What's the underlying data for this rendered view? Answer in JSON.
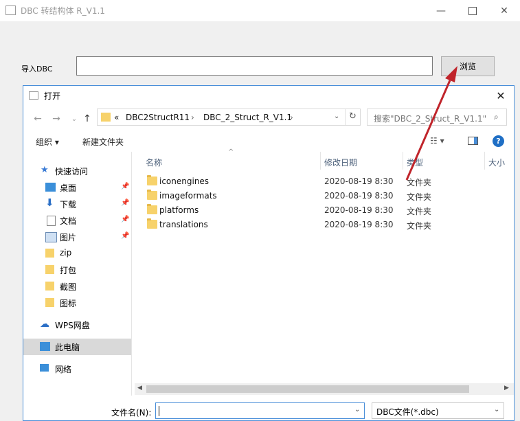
{
  "main_window": {
    "title": "DBC 转结构体 R_V1.1",
    "dbc_label": "导入DBC",
    "dbc_value": "",
    "browse_label": "浏览"
  },
  "dialog": {
    "title": "打开",
    "address": [
      "DBC2StructR11",
      "DBC_2_Struct_R_V1.1"
    ],
    "address_prefix": "«",
    "search_placeholder": "搜索\"DBC_2_Struct_R_V1.1\"",
    "toolbar": {
      "organize": "组织 ▾",
      "new_folder": "新建文件夹"
    },
    "nav": [
      {
        "label": "快速访问",
        "icon": "star-icon"
      },
      {
        "label": "桌面",
        "icon": "desktop-icon",
        "pinned": true
      },
      {
        "label": "下载",
        "icon": "download-icon",
        "pinned": true
      },
      {
        "label": "文档",
        "icon": "document-icon",
        "pinned": true
      },
      {
        "label": "图片",
        "icon": "picture-icon",
        "pinned": true
      },
      {
        "label": "zip",
        "icon": "folder-icon"
      },
      {
        "label": "打包",
        "icon": "folder-icon"
      },
      {
        "label": "截图",
        "icon": "folder-icon"
      },
      {
        "label": "图标",
        "icon": "folder-icon"
      },
      {
        "label": "WPS网盘",
        "icon": "cloud-icon"
      },
      {
        "label": "此电脑",
        "icon": "computer-icon"
      },
      {
        "label": "网络",
        "icon": "network-icon"
      }
    ],
    "columns": [
      "名称",
      "修改日期",
      "类型",
      "大小"
    ],
    "files": [
      {
        "name": "iconengines",
        "date": "2020-08-19 8:30",
        "type": "文件夹"
      },
      {
        "name": "imageformats",
        "date": "2020-08-19 8:30",
        "type": "文件夹"
      },
      {
        "name": "platforms",
        "date": "2020-08-19 8:30",
        "type": "文件夹"
      },
      {
        "name": "translations",
        "date": "2020-08-19 8:30",
        "type": "文件夹"
      }
    ],
    "filename_label": "文件名(N):",
    "filename_value": "",
    "filetype": "DBC文件(*.dbc)"
  },
  "colors": {
    "accent": "#4a8fd9",
    "arrow": "#c0242b",
    "selected": "#d9d9d9"
  }
}
